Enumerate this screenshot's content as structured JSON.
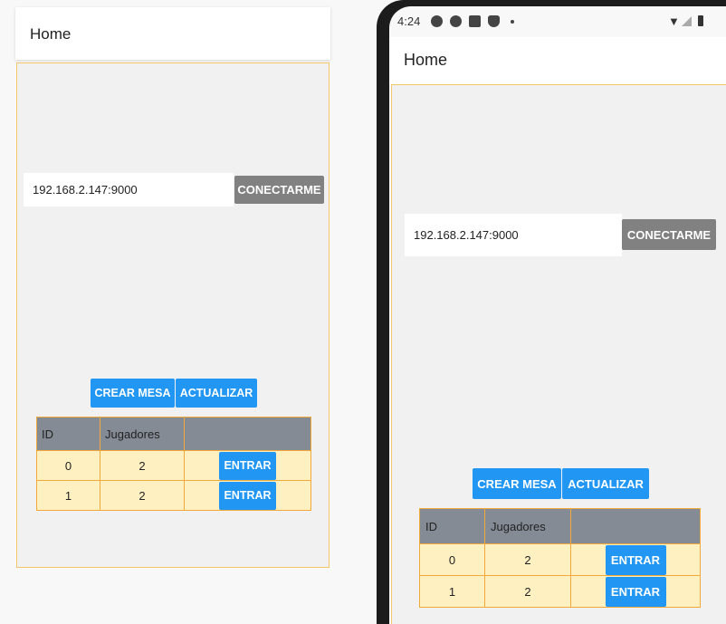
{
  "colors": {
    "primary_button": "#2196f3",
    "connect_button": "#818181",
    "table_header": "#848b95",
    "table_row": "#fff0c2",
    "border_accent": "#f0a93a"
  },
  "browser_view": {
    "header_title": "Home",
    "ip_input_value": "192.168.2.147:9000",
    "connect_label": "CONECTARME",
    "create_table_label": "CREAR MESA",
    "refresh_label": "ACTUALIZAR",
    "table": {
      "headers": [
        "ID",
        "Jugadores",
        ""
      ],
      "rows": [
        {
          "id": "0",
          "players": "2",
          "action": "ENTRAR"
        },
        {
          "id": "1",
          "players": "2",
          "action": "ENTRAR"
        }
      ]
    }
  },
  "phone_view": {
    "status_time": "4:24",
    "status_icons": [
      "gear-icon",
      "a-icon",
      "a-outline-icon",
      "shield-icon",
      "dot-icon",
      "wifi-icon",
      "signal-icon",
      "battery-icon"
    ],
    "header_title": "Home",
    "ip_input_value": "192.168.2.147:9000",
    "connect_label": "CONECTARME",
    "create_table_label": "CREAR MESA",
    "refresh_label": "ACTUALIZAR",
    "table": {
      "headers": [
        "ID",
        "Jugadores",
        ""
      ],
      "rows": [
        {
          "id": "0",
          "players": "2",
          "action": "ENTRAR"
        },
        {
          "id": "1",
          "players": "2",
          "action": "ENTRAR"
        }
      ]
    }
  }
}
